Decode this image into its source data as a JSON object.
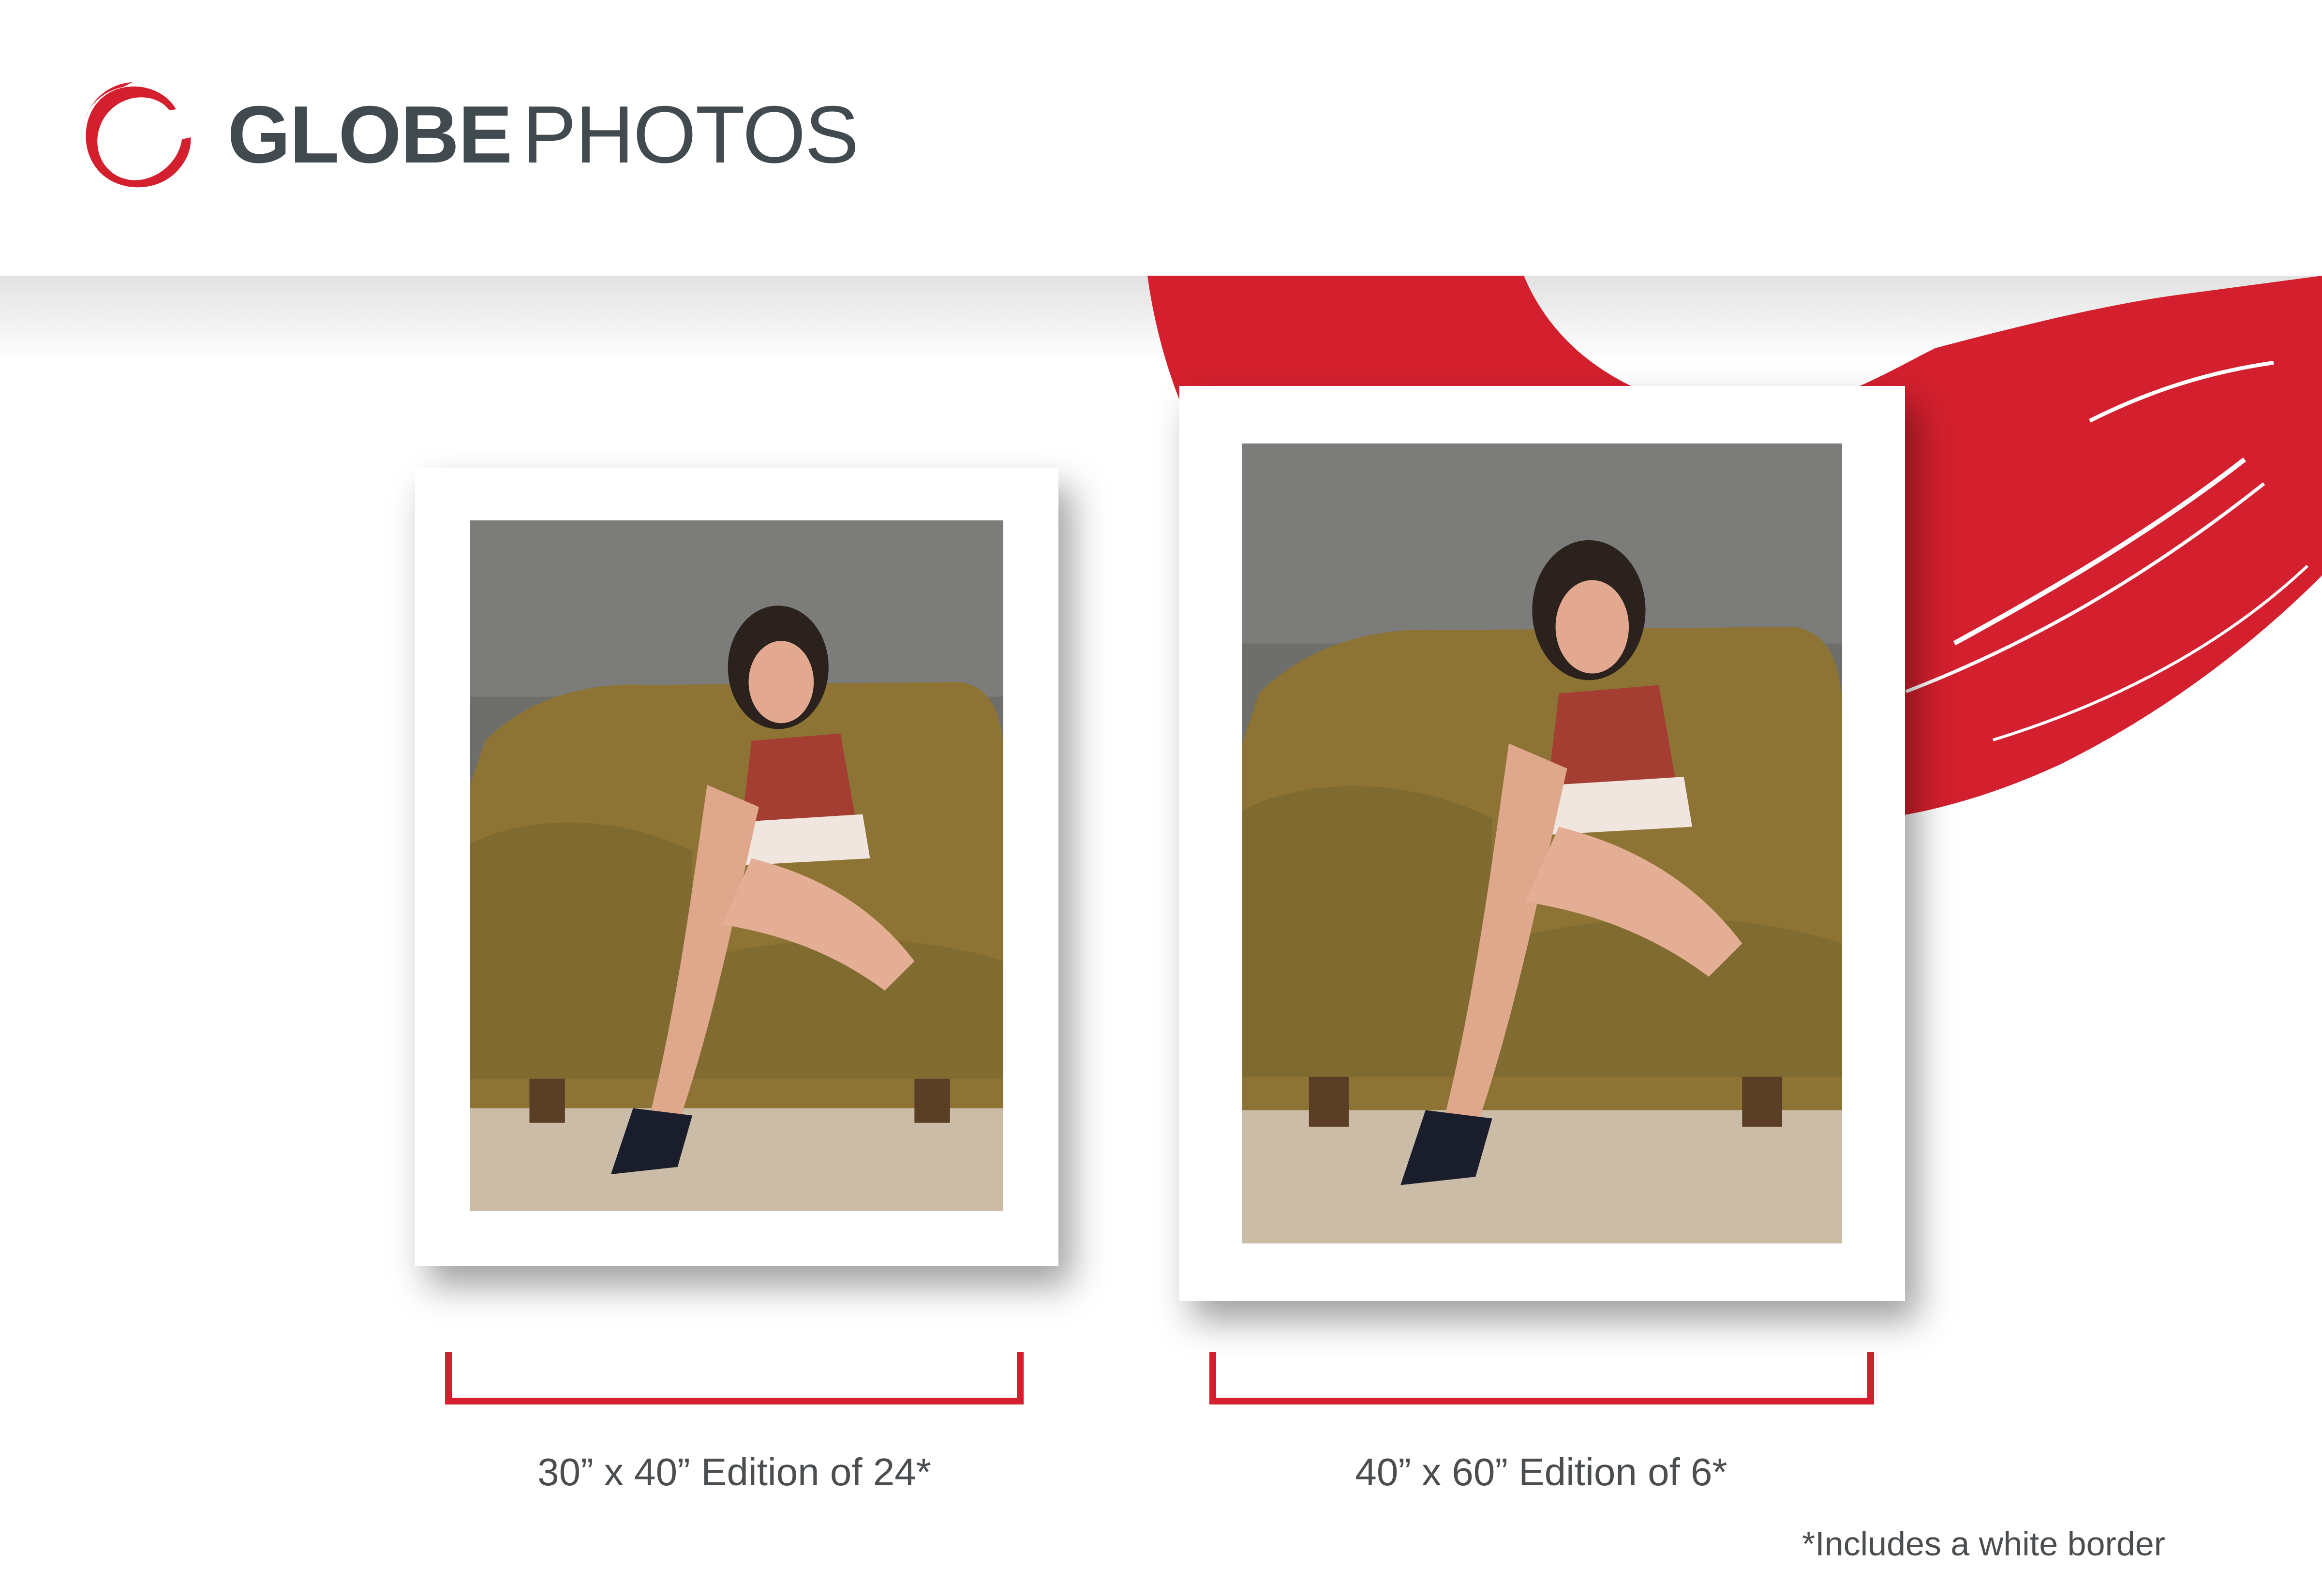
{
  "brand": {
    "name_bold": "GLOBE",
    "name_light": "PHOTOS",
    "logo_icon": "red-brush-ring-icon",
    "text_color": "#414a4f",
    "accent_color": "#d4202e"
  },
  "editions": [
    {
      "label": "30” x 40” Edition of 24*"
    },
    {
      "label": "40” x 60” Edition of 6*"
    }
  ],
  "footnote": "*Includes a white border"
}
